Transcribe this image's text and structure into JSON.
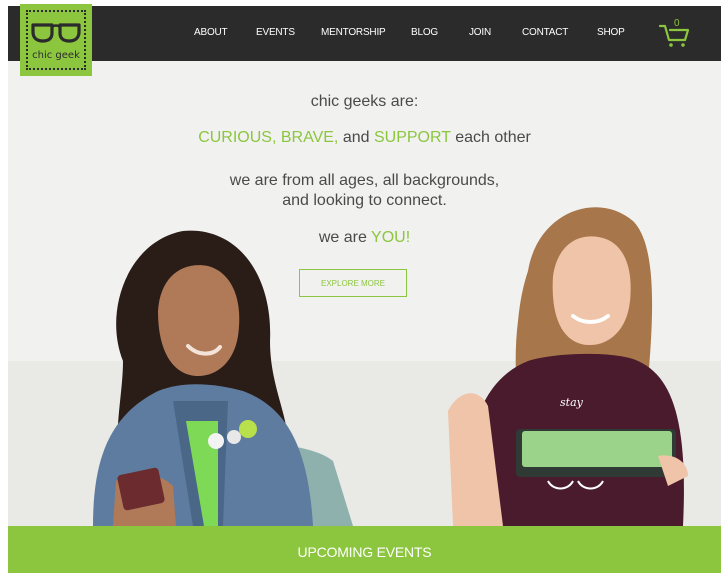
{
  "logo": {
    "text": "chic geek"
  },
  "nav": {
    "items": [
      "ABOUT",
      "EVENTS",
      "MENTORSHIP",
      "BLOG",
      "JOIN",
      "CONTACT",
      "SHOP"
    ],
    "cart_count": "0"
  },
  "hero": {
    "line1": "chic geeks are:",
    "line2": {
      "w1": "CURIOUS,",
      "w2": "BRAVE,",
      "w3": "and",
      "w4": "SUPPORT",
      "w5": "each other"
    },
    "line3a": "we are from all ages, all backgrounds,",
    "line3b": "and looking to connect.",
    "line4": {
      "pre": "we are",
      "emph": "YOU!"
    },
    "button_label": "EXPLORE MORE",
    "tablet_text": "stay"
  },
  "events": {
    "title": "UPCOMING EVENTS"
  },
  "colors": {
    "accent": "#8cc63f",
    "header_bg": "#2b2b2b",
    "text": "#4a4a4a"
  }
}
